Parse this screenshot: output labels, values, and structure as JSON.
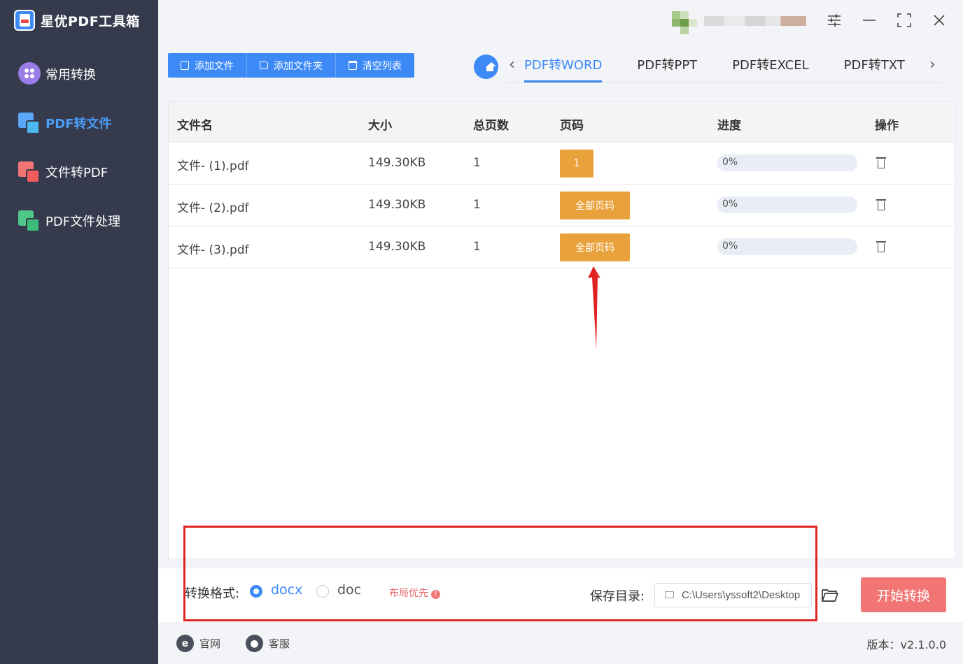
{
  "app": {
    "title": "星优PDF工具箱",
    "version": "版本：v2.1.0.0"
  },
  "sidebar": {
    "items": [
      {
        "label": "常用转换",
        "icon": "grid-flower-icon",
        "active": false
      },
      {
        "label": "PDF转文件",
        "icon": "pdf-to-file-icon",
        "active": true
      },
      {
        "label": "文件转PDF",
        "icon": "file-to-pdf-icon",
        "active": false
      },
      {
        "label": "PDF文件处理",
        "icon": "pdf-process-icon",
        "active": false
      }
    ]
  },
  "toolbar": {
    "add_file": "添加文件",
    "add_folder": "添加文件夹",
    "clear_list": "清空列表"
  },
  "tabs": [
    "PDF转WORD",
    "PDF转PPT",
    "PDF转EXCEL",
    "PDF转TXT"
  ],
  "table": {
    "headers": [
      "文件名",
      "大小",
      "总页数",
      "页码",
      "进度",
      "操作"
    ],
    "rows": [
      {
        "name": "文件- (1).pdf",
        "size": "149.30KB",
        "pages": "1",
        "page_btn": "1",
        "progress": "0%"
      },
      {
        "name": "文件- (2).pdf",
        "size": "149.30KB",
        "pages": "1",
        "page_btn": "全部页码",
        "progress": "0%"
      },
      {
        "name": "文件- (3).pdf",
        "size": "149.30KB",
        "pages": "1",
        "page_btn": "全部页码",
        "progress": "0%"
      }
    ]
  },
  "format": {
    "label": "转换格式:",
    "options": [
      "docx",
      "doc"
    ],
    "selected": "docx",
    "layout_tip": "布局优先"
  },
  "save": {
    "label": "保存目录:",
    "path": "C:\\Users\\yssoft2\\Desktop"
  },
  "start_button": "开始转换",
  "footer": {
    "website": "官网",
    "support": "客服"
  },
  "colors": {
    "accent": "#3d8af7",
    "sidebar": "#353b4c",
    "page_button": "#e9a13b",
    "start_button": "#f27575",
    "annotation": "#e02424"
  }
}
